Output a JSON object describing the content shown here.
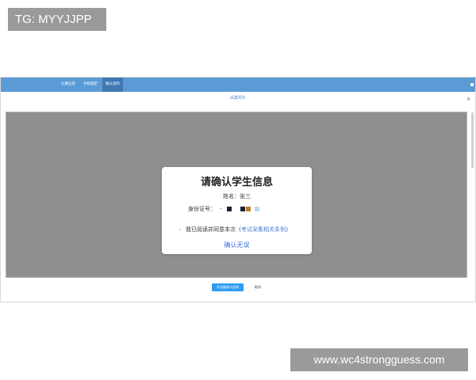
{
  "watermarks": {
    "tag": "TG: MYYJJPP",
    "site": "www.wc4strongguess.com"
  },
  "topbar": {
    "nav": [
      {
        "label": "比赛信息",
        "active": false
      },
      {
        "label": "手机绑定",
        "active": false
      },
      {
        "label": "确认资料",
        "active": true
      }
    ]
  },
  "dialog": {
    "title": "采集照片",
    "close_icon": "close-icon"
  },
  "card": {
    "title": "请确认学生信息",
    "name_label": "姓名：",
    "name_value": "张三",
    "id_label": "身份证号：",
    "id_dash": "-",
    "id_swatches": [
      "#1a1f33",
      "#1a1f33",
      "#c07a2a",
      "#bcd9ee"
    ],
    "agree_prefix": "我已阅读并同意本次",
    "agree_link": "《考试采集相关条例》",
    "confirm_button": "确认无误"
  },
  "footer": {
    "primary_button": "开启摄像头拍照",
    "cancel_button": "取消"
  },
  "colors": {
    "accent": "#5b9bd5",
    "preview_bg": "#8f8f8f",
    "primary_button": "#2e9cf2",
    "link": "#4a7fd1"
  }
}
